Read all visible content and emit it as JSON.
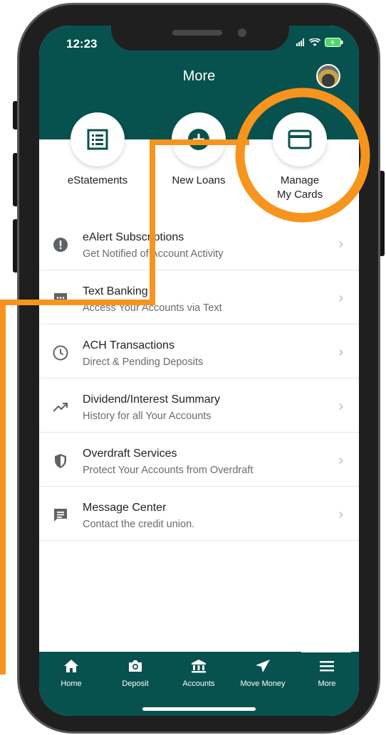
{
  "status": {
    "time": "12:23"
  },
  "header": {
    "title": "More"
  },
  "shortcuts": [
    {
      "label": "eStatements"
    },
    {
      "label": "New Loans"
    },
    {
      "label": "Manage\nMy Cards"
    }
  ],
  "list": [
    {
      "title": "eAlert Subscriptions",
      "subtitle": "Get Notified of Account Activity",
      "icon": "alert-icon"
    },
    {
      "title": "Text Banking",
      "subtitle": "Access Your Accounts via Text",
      "icon": "chat-icon"
    },
    {
      "title": "ACH Transactions",
      "subtitle": "Direct & Pending Deposits",
      "icon": "clock-icon"
    },
    {
      "title": "Dividend/Interest Summary",
      "subtitle": "History for all Your Accounts",
      "icon": "trending-up-icon"
    },
    {
      "title": "Overdraft Services",
      "subtitle": "Protect Your Accounts from Overdraft",
      "icon": "shield-icon"
    },
    {
      "title": "Message Center",
      "subtitle": "Contact the credit union.",
      "icon": "message-icon"
    }
  ],
  "tabs": [
    {
      "label": "Home",
      "icon": "home-icon"
    },
    {
      "label": "Deposit",
      "icon": "camera-icon"
    },
    {
      "label": "Accounts",
      "icon": "bank-icon"
    },
    {
      "label": "Move Money",
      "icon": "send-icon"
    },
    {
      "label": "More",
      "icon": "menu-icon"
    }
  ],
  "colors": {
    "brand": "#07524e",
    "highlight": "#f7941d"
  }
}
